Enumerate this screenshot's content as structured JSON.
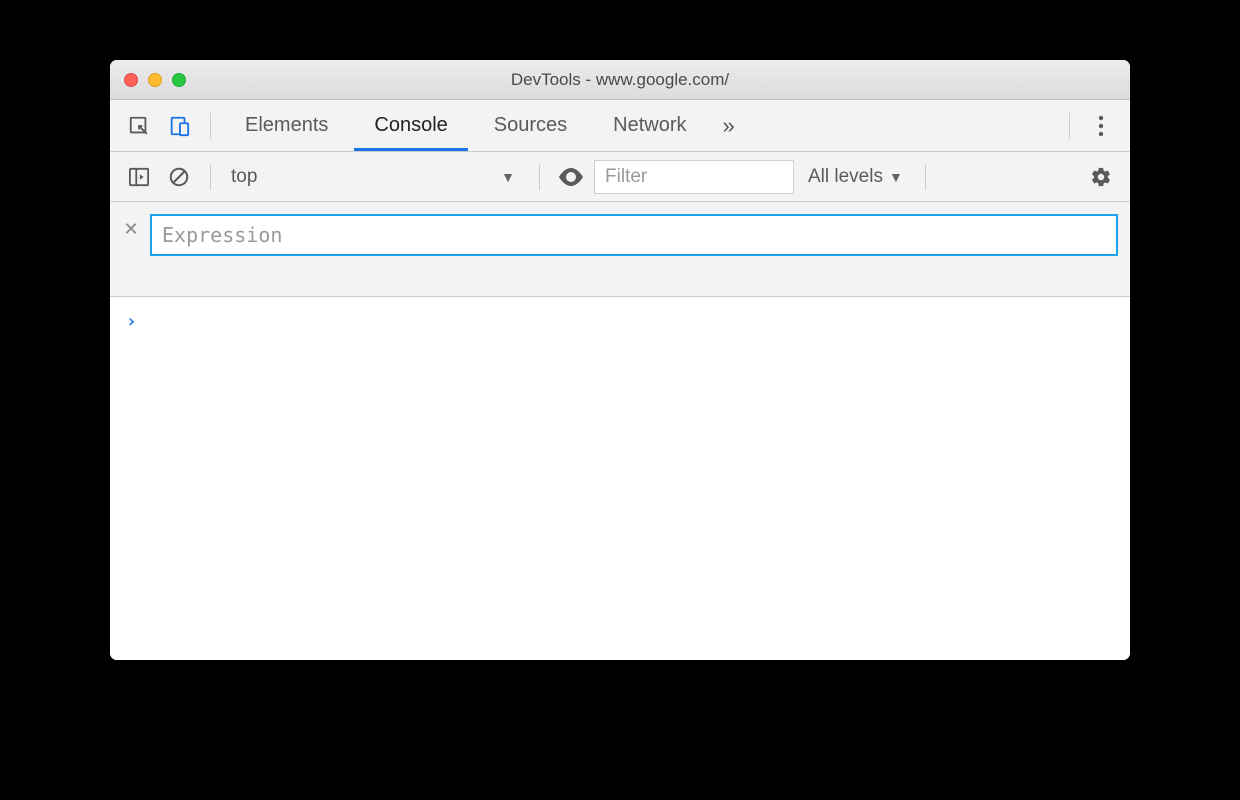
{
  "window": {
    "title": "DevTools - www.google.com/"
  },
  "tabs": {
    "elements": "Elements",
    "console": "Console",
    "sources": "Sources",
    "network": "Network",
    "active": "Console"
  },
  "console_toolbar": {
    "context": "top",
    "filter_placeholder": "Filter",
    "levels_label": "All levels"
  },
  "live_expression": {
    "placeholder": "Expression",
    "value": ""
  },
  "prompt": "›"
}
